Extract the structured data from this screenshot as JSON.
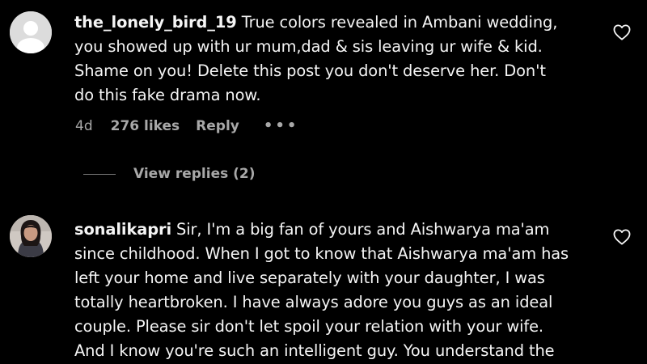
{
  "comments": [
    {
      "username": "the_lonely_bird_19",
      "lines": [
        "True colors revealed in Ambani wedding,",
        "you showed up with ur mum,dad & sis leaving ur wife & kid.",
        "Shame on you! Delete this post you don't deserve her. Don't",
        "do this fake drama now."
      ],
      "time": "4d",
      "likes": "276 likes",
      "reply_label": "Reply",
      "more_label": "•••",
      "view_replies": "View replies (2)",
      "avatar_icon": "default-avatar-icon",
      "like_icon": "heart-outline-icon"
    },
    {
      "username": "sonalikapri",
      "lines": [
        "Sir, I'm a big fan of yours and Aishwarya ma'am",
        "since childhood. When I got to know that Aishwarya ma'am has",
        "left your home and live separately with your daughter, I was",
        "totally heartbroken. I have always adore you guys as an ideal",
        "couple. Please sir don't let spoil your relation with your wife.",
        "And I know you're such an intelligent guy. You understand the"
      ],
      "avatar_icon": "profile-photo-avatar",
      "like_icon": "heart-outline-icon"
    }
  ],
  "colors": {
    "background": "#000000",
    "primary_text": "#f5f5f5",
    "secondary_text": "#a8a8a8"
  }
}
